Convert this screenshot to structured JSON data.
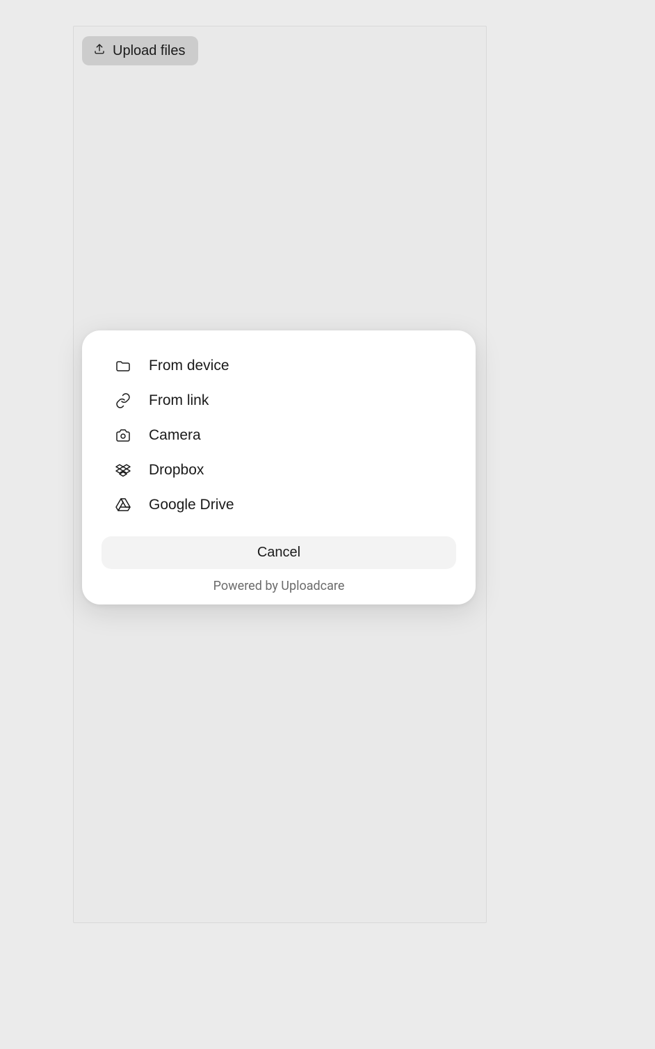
{
  "upload_button": {
    "label": "Upload files"
  },
  "sources": [
    {
      "id": "device",
      "label": "From device"
    },
    {
      "id": "link",
      "label": "From link"
    },
    {
      "id": "camera",
      "label": "Camera"
    },
    {
      "id": "dropbox",
      "label": "Dropbox"
    },
    {
      "id": "gdrive",
      "label": "Google Drive"
    }
  ],
  "cancel_label": "Cancel",
  "powered_by": "Powered by Uploadcare"
}
